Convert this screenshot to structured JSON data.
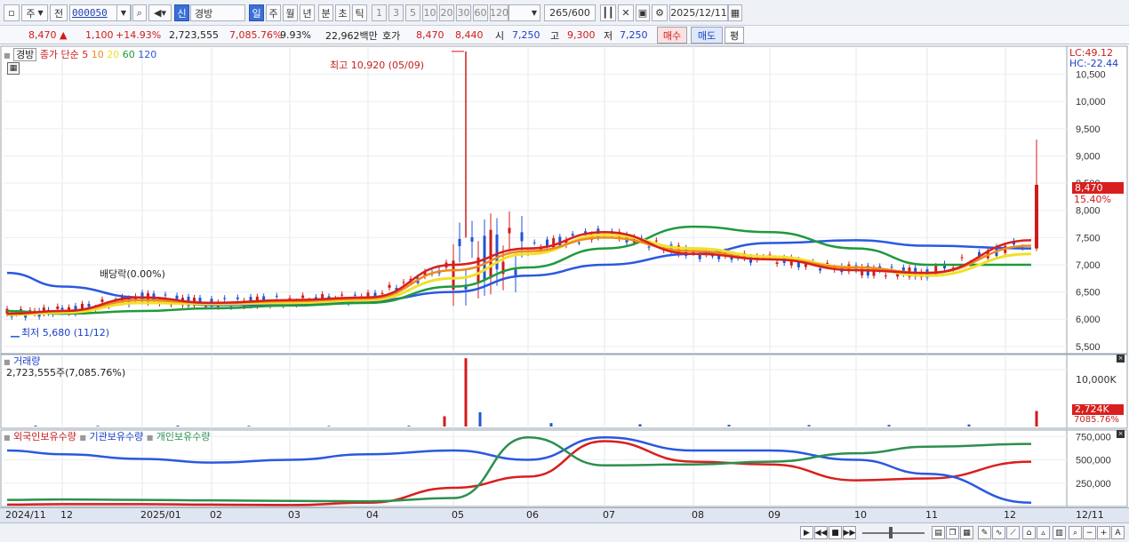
{
  "toolbar": {
    "period_type": "주",
    "prev_label": "전",
    "stock_code": "000050",
    "new_label": "신",
    "stock_name": "경방",
    "tf_day": "일",
    "tf_week": "주",
    "tf_month": "월",
    "tf_year": "년",
    "tf_min": "분",
    "tf_sec": "초",
    "tf_tick": "틱",
    "n_buttons": [
      "1",
      "3",
      "5",
      "10",
      "20",
      "30",
      "60",
      "120"
    ],
    "view_count": "265",
    "view_total": "/600",
    "date": "2025/12/11"
  },
  "quote": {
    "price": "8,470",
    "arrow": "▲",
    "change": "1,100",
    "change_pct": "+14.93%",
    "volume": "2,723,555",
    "volume_ratio": "7,085.76%",
    "turnover": "9.93%",
    "amount": "22,962백만",
    "bidask_label": "호가",
    "ask": "8,470",
    "bid": "8,440",
    "open_label": "시",
    "open": "7,250",
    "high_label": "고",
    "high": "9,300",
    "low_label": "저",
    "low": "7,250",
    "buy_label": "매수",
    "sell_label": "매도",
    "eval_label": "평"
  },
  "price_panel": {
    "name_tag": "경방",
    "legend_label": "종가 단순",
    "ma_periods": [
      "5",
      "10",
      "20",
      "60",
      "120"
    ],
    "lc_label": "LC:49.12",
    "hc_label": "HC:-22.44",
    "current_price_tag": "8,470",
    "current_pct_tag": "15.40%",
    "high_annotation": "최고 10,920 (05/09)",
    "low_annotation": "최저 5,680 (11/12)",
    "dividend_annotation": "배당락(0.00%)"
  },
  "volume_panel": {
    "title": "거래량",
    "subtitle": "2,723,555주(7,085.76%)",
    "tick_label": "10,000K",
    "current_tag": "2,724K",
    "current_pct": "7085.76%"
  },
  "holdings_panel": {
    "foreign_label": "외국인보유수량",
    "inst_label": "기관보유수량",
    "indiv_label": "개인보유수량"
  },
  "xaxis": {
    "labels": [
      "2024/11",
      "12",
      "2025/01",
      "02",
      "03",
      "04",
      "05",
      "06",
      "07",
      "08",
      "09",
      "10",
      "11",
      "12"
    ],
    "end_label": "12/11"
  },
  "colors": {
    "up": "#d01b1b",
    "down": "#1f55d6",
    "ma5": "#d81f1f",
    "ma10": "#f08a1a",
    "ma20": "#f1e02a",
    "ma60": "#1f9a3d",
    "ma120": "#2a58e0",
    "foreign": "#d81f1f",
    "institution": "#2a58e0",
    "individual": "#2c8f4f"
  },
  "chart_data": [
    {
      "type": "line",
      "title": "경방 종가 단순 이동평균",
      "ylim": [
        5400,
        10950
      ],
      "yticks": [
        "10,500",
        "10,000",
        "9,500",
        "9,000",
        "8,500",
        "8,000",
        "7,500",
        "7,000",
        "6,500",
        "6,000",
        "5,500"
      ],
      "x": [
        "2024/11",
        "12",
        "2025/01",
        "02",
        "03",
        "04",
        "05",
        "06",
        "07",
        "08",
        "09",
        "10",
        "11",
        "12/11"
      ],
      "series": [
        {
          "name": "5",
          "values": [
            6100,
            6150,
            6400,
            6300,
            6350,
            6400,
            7000,
            7300,
            7600,
            7200,
            7100,
            6900,
            6850,
            7450
          ]
        },
        {
          "name": "10",
          "values": [
            6100,
            6150,
            6350,
            6300,
            6330,
            6380,
            6900,
            7250,
            7500,
            7250,
            7100,
            6950,
            6850,
            7350
          ]
        },
        {
          "name": "20",
          "values": [
            6080,
            6120,
            6300,
            6280,
            6300,
            6350,
            6750,
            7200,
            7550,
            7300,
            7150,
            6950,
            6800,
            7200
          ]
        },
        {
          "name": "60",
          "values": [
            6150,
            6100,
            6150,
            6200,
            6250,
            6300,
            6600,
            6950,
            7300,
            7700,
            7600,
            7300,
            7000,
            7000
          ]
        },
        {
          "name": "120",
          "values": [
            6850,
            6600,
            6400,
            6260,
            6270,
            6340,
            6500,
            6800,
            7000,
            7200,
            7400,
            7450,
            7350,
            7300
          ]
        }
      ],
      "annotations": {
        "high": "최고 10,920 (05/09)",
        "low": "최저 5,680 (11/12)",
        "last": "8,470"
      }
    },
    {
      "type": "bar",
      "title": "거래량",
      "ylim": [
        0,
        12500
      ],
      "yunit": "K",
      "categories": [
        "2024/11",
        "12",
        "2025/01",
        "02",
        "03",
        "04",
        "05(early)",
        "05/09",
        "05(late)",
        "06",
        "07",
        "08",
        "09",
        "10",
        "11",
        "12/11"
      ],
      "values": [
        150,
        120,
        160,
        130,
        110,
        140,
        1800,
        12000,
        2500,
        600,
        400,
        300,
        250,
        280,
        350,
        2724
      ]
    },
    {
      "type": "line",
      "title": "보유수량",
      "ylim": [
        0,
        800000
      ],
      "yticks": [
        "750,000",
        "500,000",
        "250,000"
      ],
      "x": [
        "2024/11",
        "12",
        "2025/01",
        "02",
        "03",
        "04",
        "05",
        "06",
        "07",
        "08",
        "09",
        "10",
        "11",
        "12/11"
      ],
      "series": [
        {
          "name": "외국인보유수량",
          "values": [
            20000,
            25000,
            25000,
            20000,
            15000,
            40000,
            200000,
            320000,
            700000,
            480000,
            450000,
            280000,
            300000,
            480000
          ]
        },
        {
          "name": "기관보유수량",
          "values": [
            600000,
            560000,
            510000,
            470000,
            500000,
            560000,
            600000,
            500000,
            740000,
            600000,
            600000,
            500000,
            350000,
            40000
          ]
        },
        {
          "name": "개인보유수량",
          "values": [
            70000,
            75000,
            70000,
            65000,
            60000,
            55000,
            90000,
            740000,
            440000,
            450000,
            480000,
            570000,
            640000,
            670000
          ]
        }
      ]
    }
  ]
}
